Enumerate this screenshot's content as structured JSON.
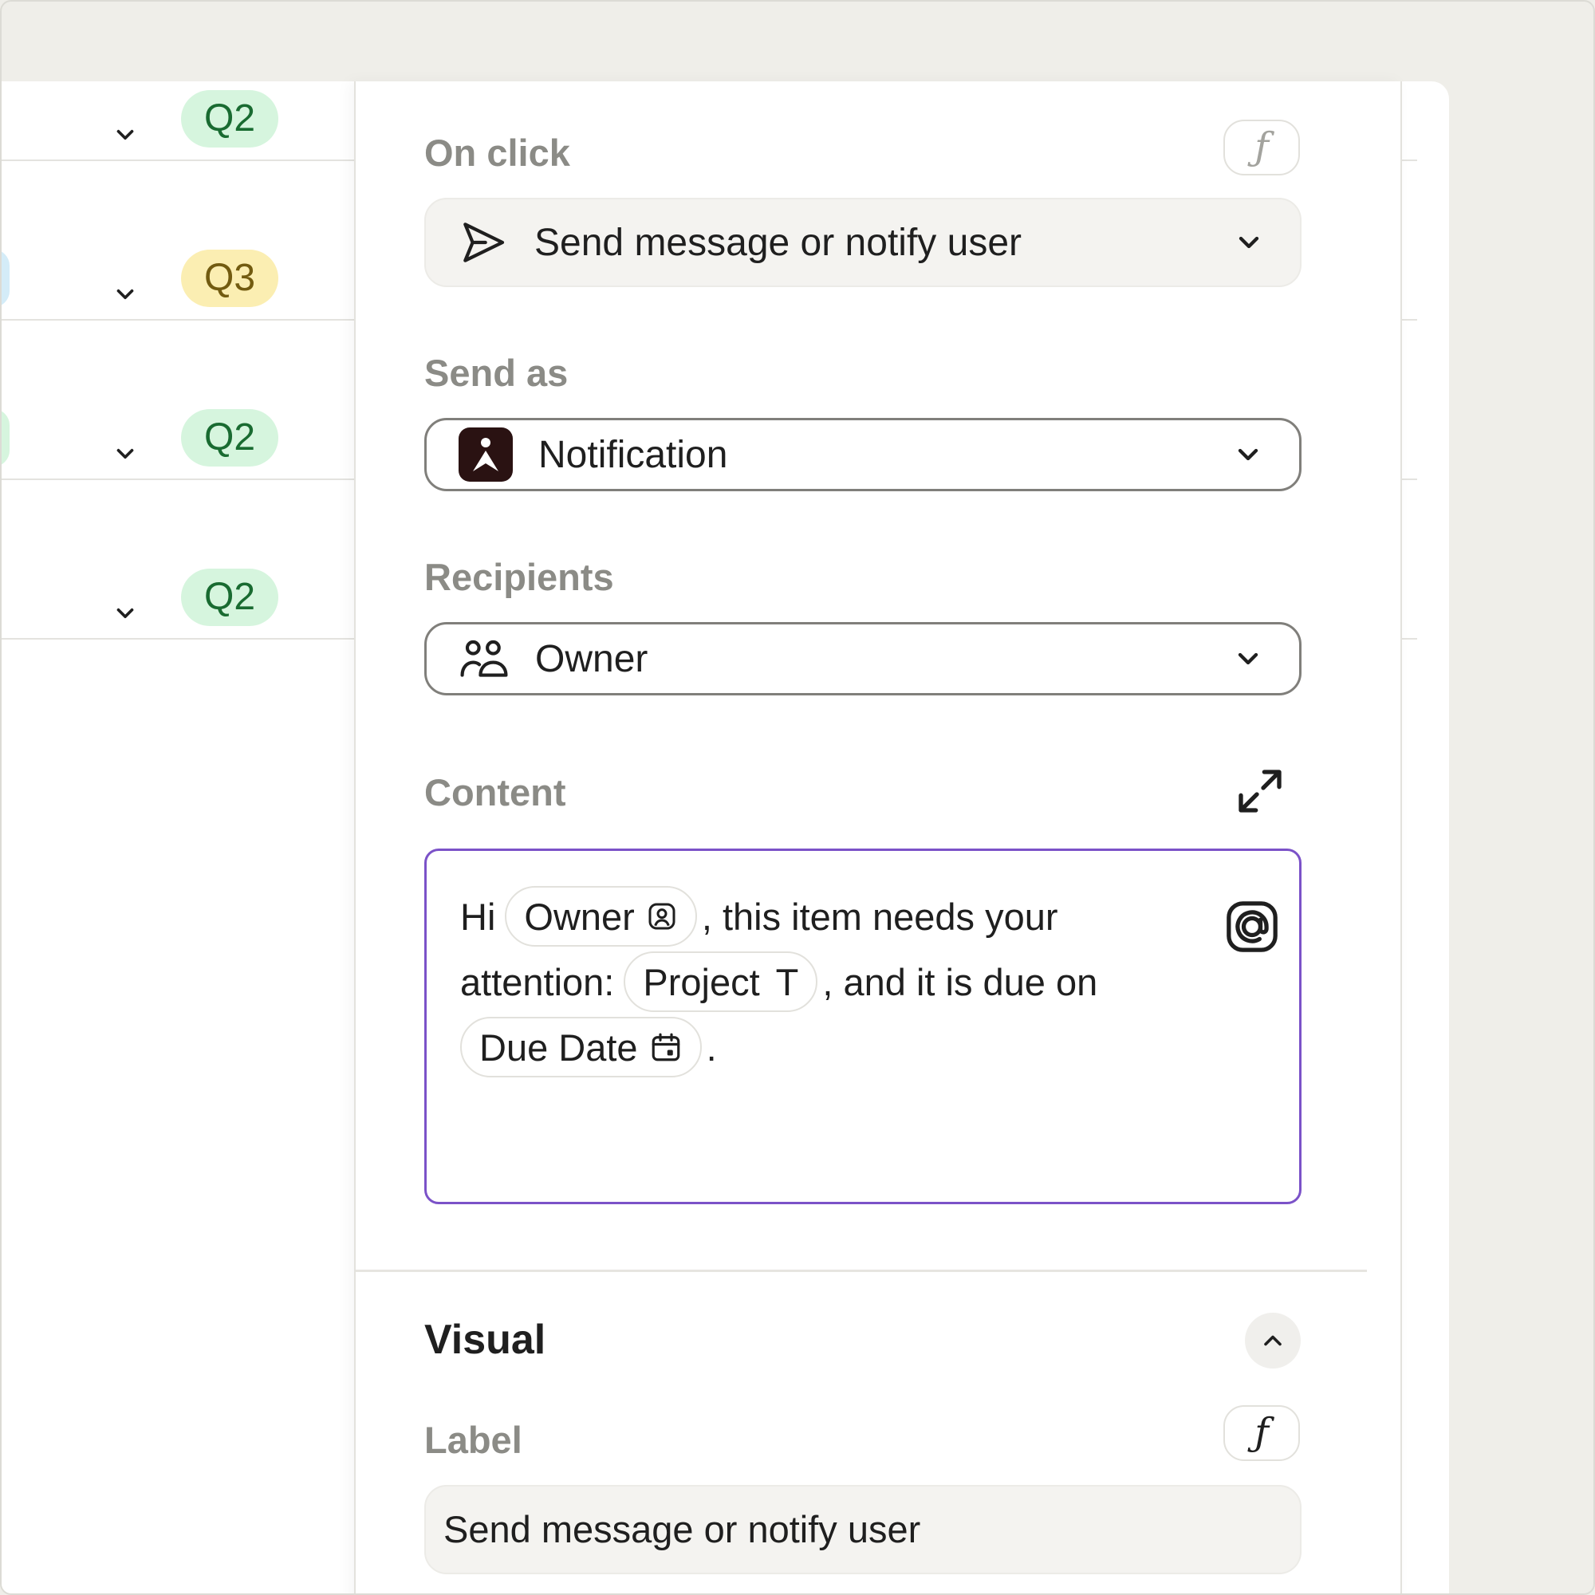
{
  "table": {
    "rows": [
      {
        "quarter": "Q2",
        "tone": "green"
      },
      {
        "quarter": "Q3",
        "tone": "yellow"
      },
      {
        "quarter": "Q2",
        "tone": "green"
      },
      {
        "quarter": "Q2",
        "tone": "green"
      }
    ]
  },
  "panel": {
    "on_click": {
      "label": "On click",
      "fx_symbol": "ƒ",
      "action_value": "Send message or notify user",
      "action_icon": "send-icon"
    },
    "send_as": {
      "label": "Send as",
      "value": "Notification",
      "icon": "app-logo-icon"
    },
    "recipients": {
      "label": "Recipients",
      "value": "Owner",
      "icon": "people-icon"
    },
    "content": {
      "label": "Content",
      "text_hi": "Hi",
      "chip_owner": "Owner",
      "text_1": ", this item needs your",
      "text_attention": "attention:",
      "chip_project": "Project",
      "chip_project_type": "T",
      "text_2": ", and it is due on",
      "chip_due": "Due Date",
      "text_end": "."
    },
    "visual": {
      "title": "Visual",
      "label_label": "Label",
      "fx_symbol": "ƒ",
      "label_value": "Send message or notify user"
    }
  },
  "colors": {
    "accent_focus": "#7b52c8",
    "badge_green_bg": "#d6f5de",
    "badge_yellow_bg": "#fbeeb2",
    "app_icon_bg": "#2a1212"
  }
}
